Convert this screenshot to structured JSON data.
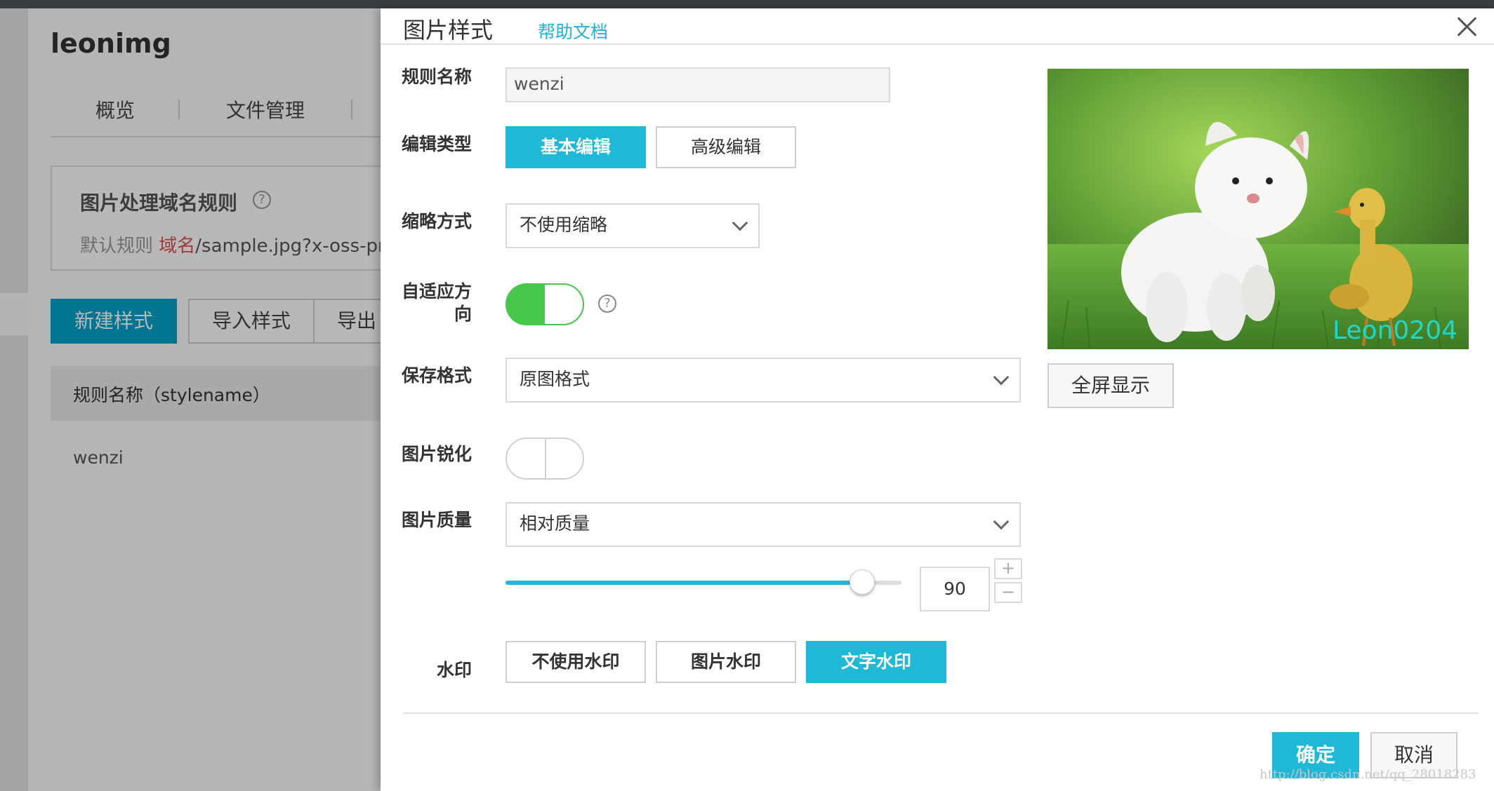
{
  "background": {
    "app_title": "leonimg",
    "tabs": [
      "概览",
      "文件管理"
    ],
    "panel_title": "图片处理域名规则",
    "rule_prefix": "默认规则",
    "rule_domain": "域名",
    "rule_path": "/sample.jpg?x-oss-proc",
    "buttons": [
      "新建样式",
      "导入样式",
      "导出"
    ],
    "table_header": "规则名称（stylename）",
    "table_row": "wenzi"
  },
  "dialog": {
    "title": "图片样式",
    "help_link": "帮助文档",
    "labels": {
      "rule_name": "规则名称",
      "edit_type": "编辑类型",
      "thumbnail": "缩略方式",
      "auto_orient_1": "自适应方",
      "auto_orient_2": "向",
      "save_format": "保存格式",
      "sharpen": "图片锐化",
      "quality": "图片质量",
      "watermark": "水印"
    },
    "rule_name_value": "wenzi",
    "edit_types": [
      "基本编辑",
      "高级编辑"
    ],
    "thumbnail_value": "不使用缩略",
    "auto_orient_on": true,
    "save_format_value": "原图格式",
    "sharpen_on": false,
    "quality_mode": "相对质量",
    "quality_value": "90",
    "quality_slider_fraction": 0.9,
    "stepper_plus": "+",
    "stepper_minus": "−",
    "watermark_options": [
      "不使用水印",
      "图片水印",
      "文字水印"
    ],
    "preview_watermark_text": "Leon0204",
    "fullscreen_button": "全屏显示",
    "ok_button": "确定",
    "cancel_button": "取消",
    "question_mark": "?"
  },
  "footer_watermark": "http://blog.csdn.net/qq_28018283",
  "colors": {
    "accent": "#1fb8d6",
    "toggle_on": "#47c84b"
  }
}
